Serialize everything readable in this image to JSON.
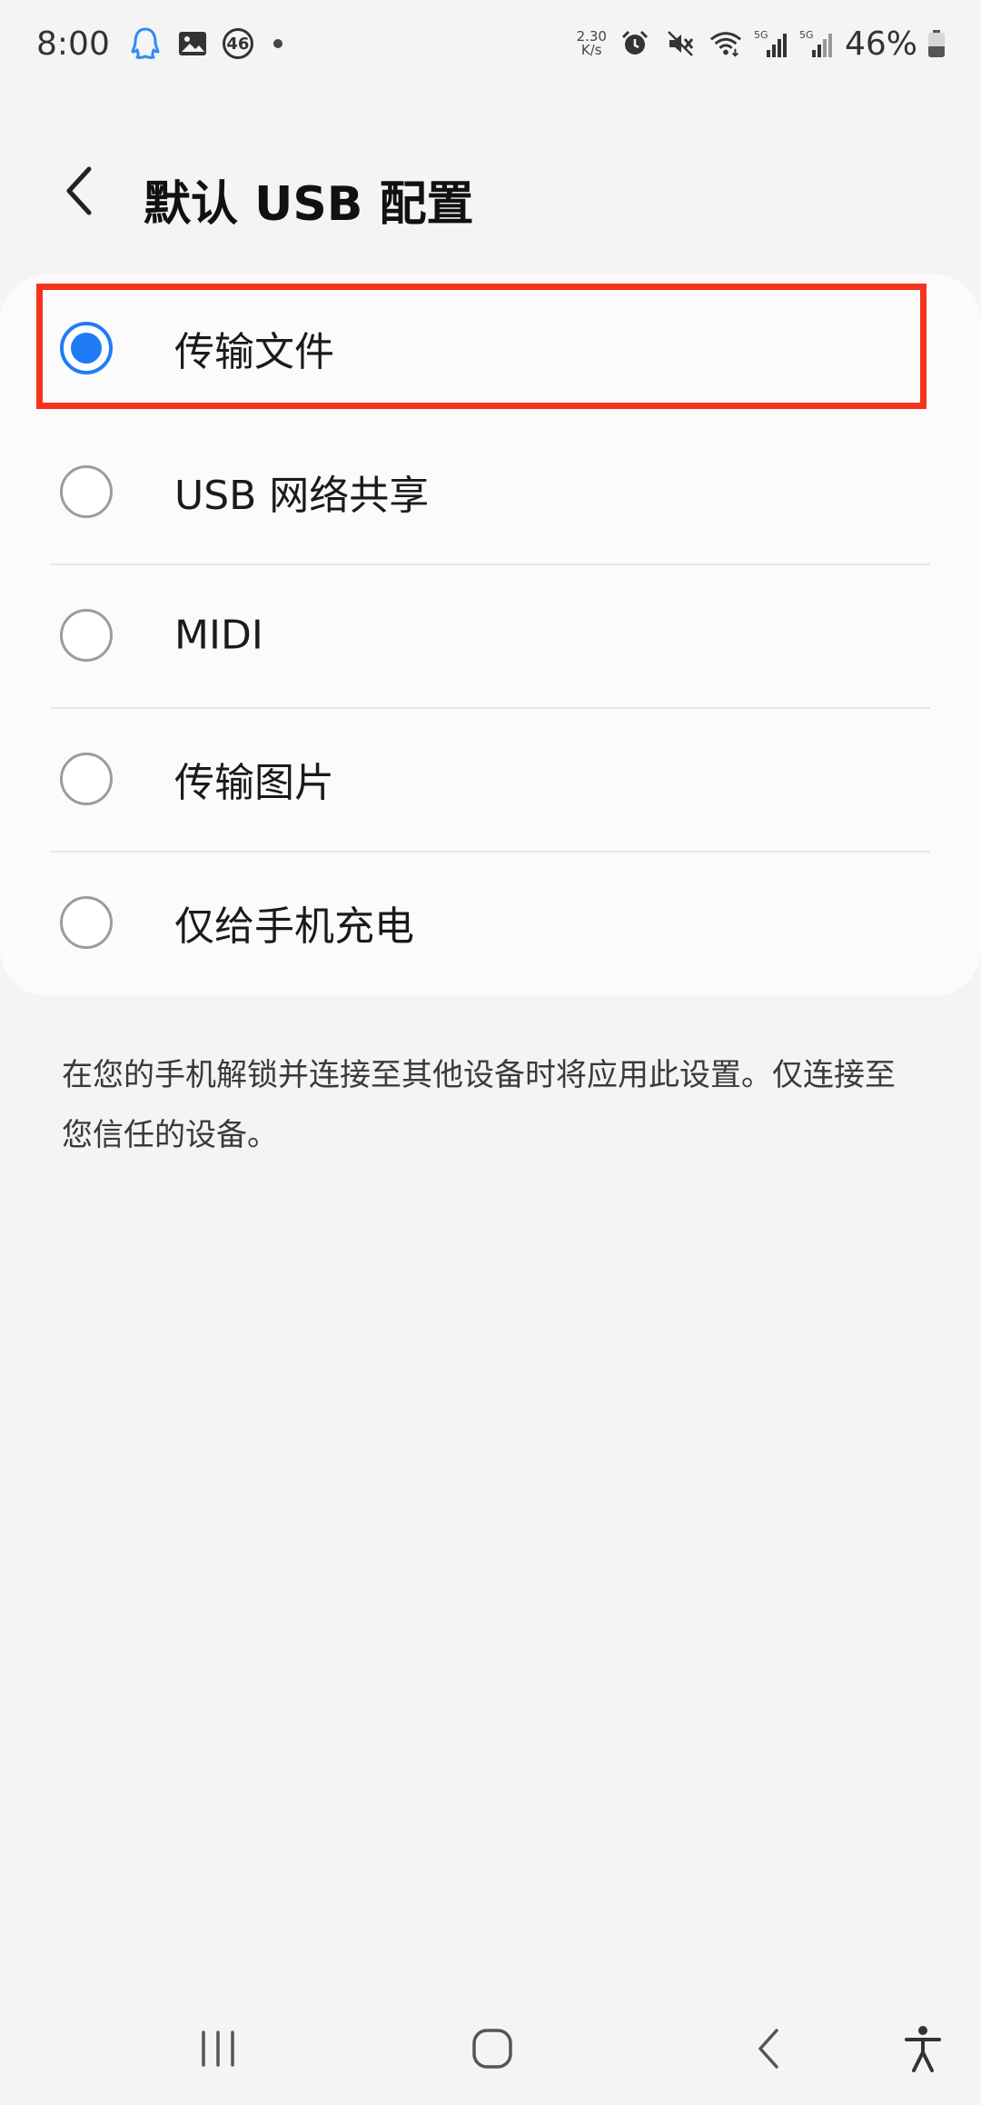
{
  "status_bar": {
    "time": "8:00",
    "badge_number": "46",
    "speed_value": "2.30",
    "speed_unit": "K/s",
    "signal_label_1": "5G",
    "signal_label_2": "5G",
    "battery_percent": "46%",
    "battery_level": 0.46,
    "icons": [
      "qq-icon",
      "gallery-icon",
      "notification-count-badge",
      "dot-indicator",
      "network-speed",
      "alarm-icon",
      "mute-icon",
      "wifi-icon",
      "signal-icon",
      "signal-icon",
      "battery-icon"
    ]
  },
  "header": {
    "back_icon": "chevron-left-icon",
    "title": "默认 USB 配置"
  },
  "options": [
    {
      "label": "传输文件",
      "selected": true
    },
    {
      "label": "USB 网络共享",
      "selected": false
    },
    {
      "label": "MIDI",
      "selected": false
    },
    {
      "label": "传输图片",
      "selected": false
    },
    {
      "label": "仅给手机充电",
      "selected": false
    }
  ],
  "description": "在您的手机解锁并连接至其他设备时将应用此设置。仅连接至您信任的设备。",
  "nav_bar": {
    "icons": [
      "recent-apps-icon",
      "home-icon",
      "back-icon",
      "accessibility-icon"
    ]
  },
  "colors": {
    "accent": "#1f7cf6",
    "highlight": "#f5331c",
    "background": "#f4f4f4",
    "card": "#fbfbfb"
  }
}
